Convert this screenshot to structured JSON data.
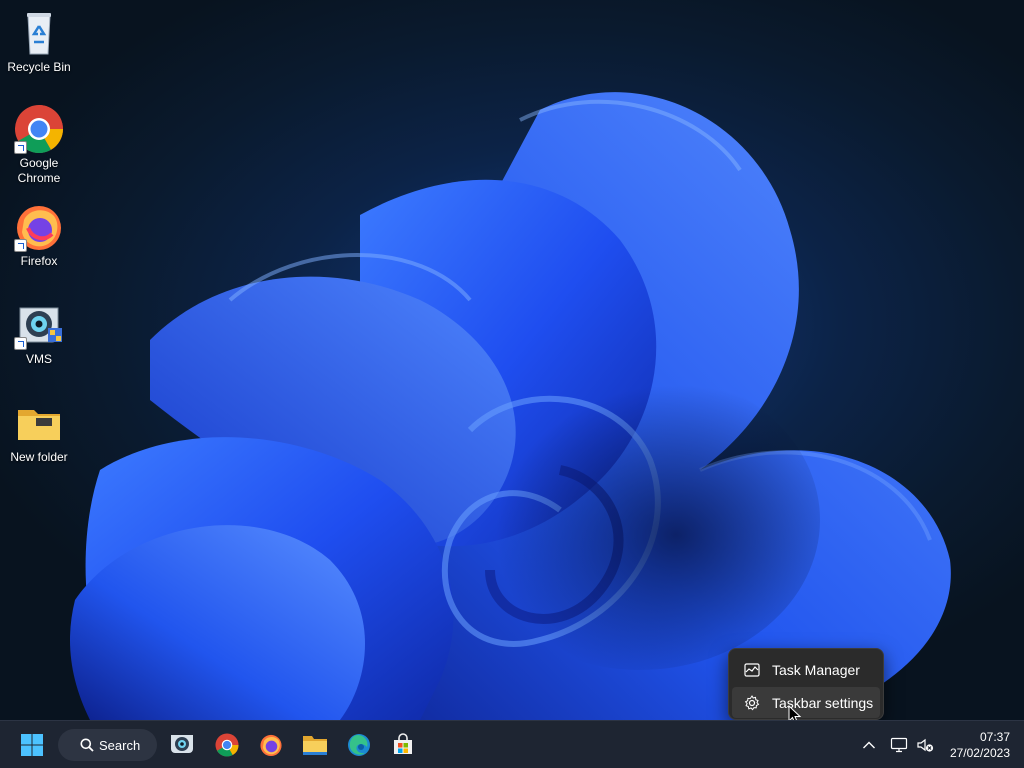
{
  "desktop": {
    "icons": [
      {
        "label_line1": "Recycle Bin",
        "label_line2": "",
        "icon": "recycle-bin-icon"
      },
      {
        "label_line1": "Google",
        "label_line2": "Chrome",
        "icon": "chrome-icon"
      },
      {
        "label_line1": "Firefox",
        "label_line2": "",
        "icon": "firefox-icon"
      },
      {
        "label_line1": "VMS",
        "label_line2": "",
        "icon": "vms-icon"
      },
      {
        "label_line1": "New folder",
        "label_line2": "",
        "icon": "folder-icon"
      }
    ]
  },
  "context_menu": {
    "items": [
      {
        "label": "Task Manager",
        "icon": "task-manager-icon"
      },
      {
        "label": "Taskbar settings",
        "icon": "gear-icon"
      }
    ]
  },
  "taskbar": {
    "search_label": "Search",
    "pinned": [
      "start-icon",
      "vms-icon",
      "chrome-icon",
      "firefox-icon",
      "file-explorer-icon",
      "edge-icon",
      "store-icon"
    ],
    "tray": {
      "icons": [
        "chevron-up-icon",
        "network-icon",
        "volume-muted-icon"
      ],
      "time": "07:37",
      "date": "27/02/2023"
    }
  },
  "colors": {
    "taskbar_bg": "#1e2532",
    "menu_bg": "#2b2b2b",
    "wallpaper_blue": "#1d4ff0"
  }
}
